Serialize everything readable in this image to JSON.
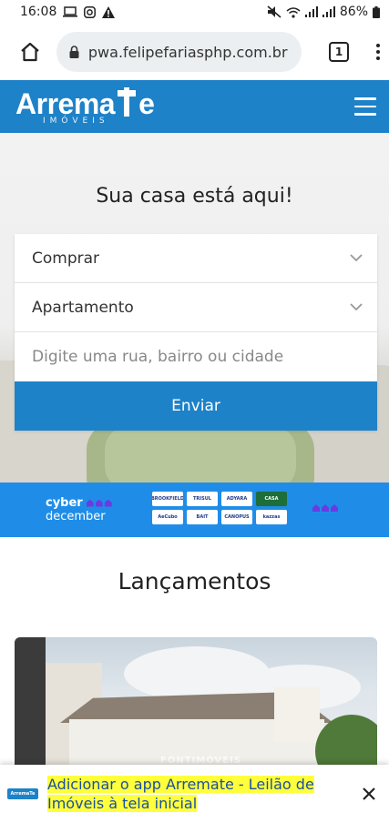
{
  "status_bar": {
    "time": "16:08",
    "battery": "86%",
    "icons": [
      "laptop-icon",
      "instagram-icon",
      "warning-icon",
      "mute-icon",
      "wifi-icon",
      "signal-icon",
      "signal-icon",
      "battery-icon"
    ]
  },
  "browser": {
    "url": "pwa.felipefariasphp.com.br",
    "tab_count": "1"
  },
  "header": {
    "logo_main_left": "Arrema",
    "logo_main_right": "e",
    "logo_sub": "IMÓVEIS",
    "brand_color": "#1e82c8"
  },
  "hero": {
    "title": "Sua casa está aqui!",
    "search": {
      "transaction_select": "Comprar",
      "property_type_select": "Apartamento",
      "location_placeholder": "Digite uma rua, bairro ou cidade",
      "submit_label": "Enviar"
    }
  },
  "promo": {
    "line1": "cyber",
    "line2": "december",
    "partners": [
      "BROOKFIELD",
      "TRISUL",
      "ADYARA",
      "CASA",
      "AeCubo",
      "BAIT",
      "CANOPUS",
      "kazzas"
    ]
  },
  "launches": {
    "title": "Lançamentos",
    "watermark": "FONTIMÓVEIS"
  },
  "install_banner": {
    "app_icon_text": "ArremaTe",
    "line1": "Adicionar o app Arremate - Leilão de",
    "line2": "Imóveis à tela inicial"
  }
}
